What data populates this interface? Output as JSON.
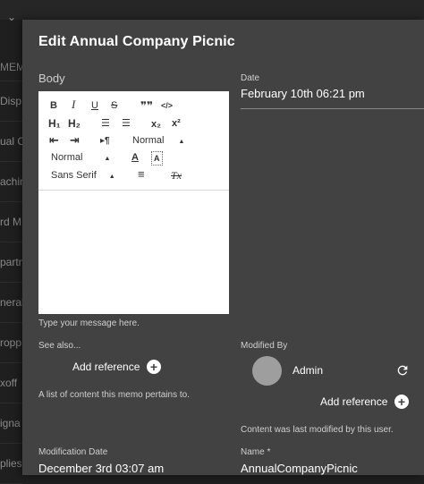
{
  "background": {
    "header_label": "MEMO",
    "rows": [
      "Disp",
      "ual C",
      "achin",
      "rd M",
      "partm",
      "neral",
      "ropp",
      "xoff",
      "igna",
      "plies"
    ]
  },
  "dialog": {
    "title": "Edit Annual Company Picnic",
    "body_label": "Body",
    "toolbar": {
      "bold": "B",
      "italic": "I",
      "underline": "U",
      "strike": "S",
      "quote": "❞❞",
      "code": "</>",
      "h1": "H₁",
      "h2": "H₂",
      "ordered_list": "☰",
      "bullet_list": "☰",
      "subscript": "x₂",
      "superscript": "x²",
      "outdent": "⇤",
      "indent": "⇥",
      "rtl": "¶",
      "size_select_1": "Normal",
      "size_select_2": "Normal",
      "font_color": "A",
      "bg_color": "A",
      "font_select": "Sans Serif",
      "align": "≡",
      "clear_format": "Tx"
    },
    "body_hint": "Type your message here.",
    "date_label": "Date",
    "date_value": "February 10th 06:21 pm",
    "see_also_label": "See also...",
    "add_reference_label": "Add reference",
    "see_also_desc": "A list of content this memo pertains to.",
    "modified_by_label": "Modified By",
    "modified_by_name": "Admin",
    "modified_add_reference_label": "Add reference",
    "modified_desc": "Content was last modified by this user.",
    "modification_date_label": "Modification Date",
    "modification_date_value": "December 3rd 03:07 am",
    "name_label": "Name *",
    "name_value": "AnnualCompanyPicnic"
  }
}
